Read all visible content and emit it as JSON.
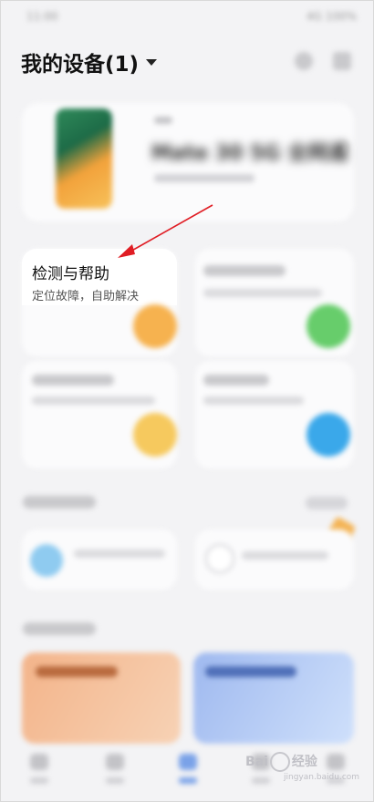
{
  "status_bar": {
    "left_text": "11:00",
    "right_text": "4G 100%"
  },
  "header": {
    "title": "我的设备(1)"
  },
  "device_card": {
    "name": "Mate 30 5G 全网通"
  },
  "tiles": {
    "detect_help": {
      "title": "检测与帮助",
      "subtitle": "定位故障，自助解决"
    }
  },
  "annotation": {
    "arrow_color": "#e01d24"
  },
  "watermark": {
    "brand": "Bai",
    "brand_suffix": "经验",
    "url": "jingyan.baidu.com"
  },
  "colors": {
    "orange_circle": "#f6b24f",
    "green_circle": "#67cd6b",
    "yellow_circle": "#f6c95e",
    "blue_circle": "#3aa8ea",
    "active_nav": "#7aa2e8"
  }
}
